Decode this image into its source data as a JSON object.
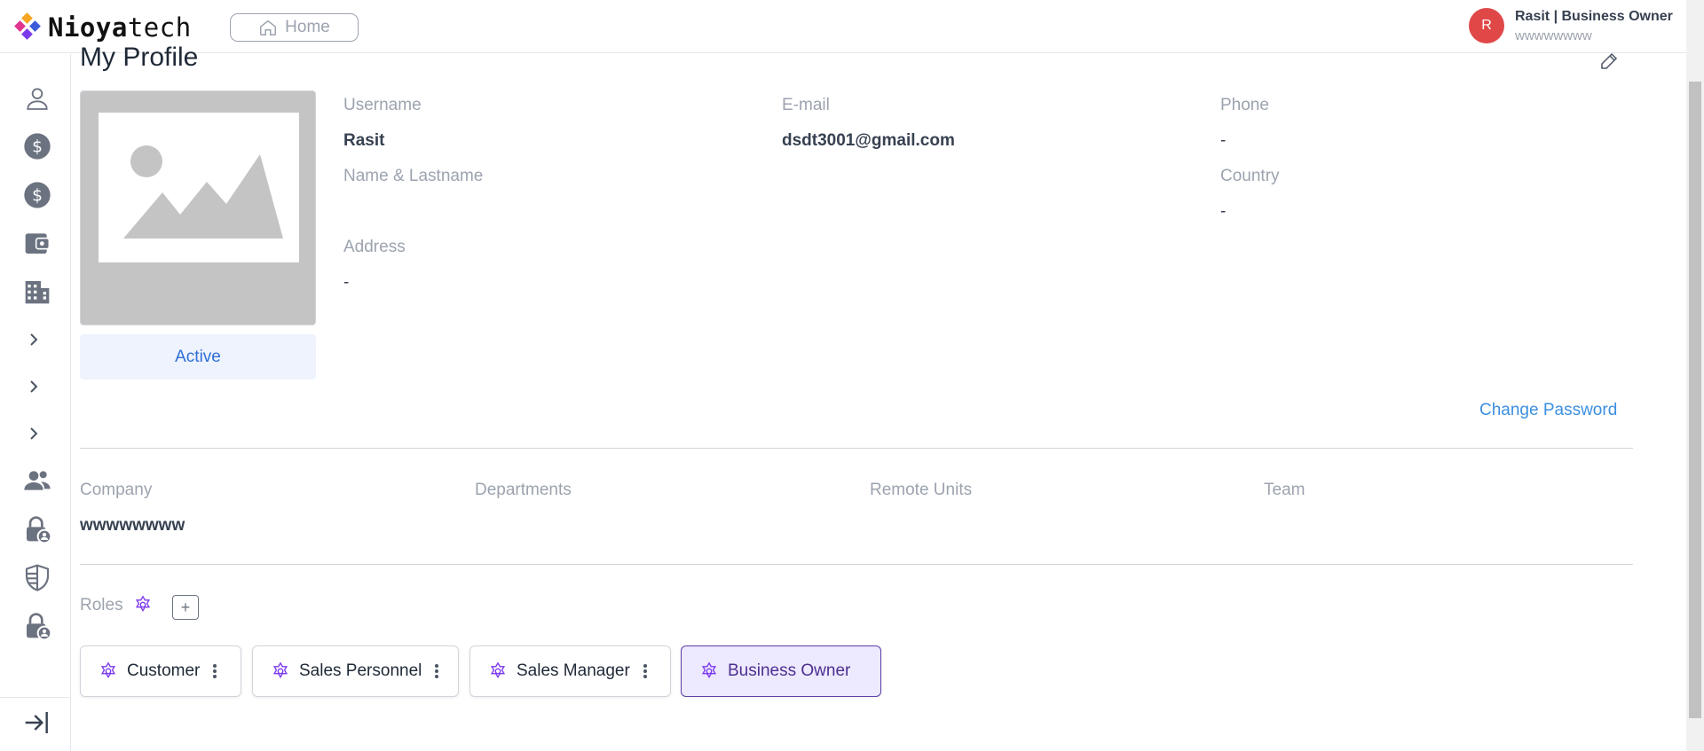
{
  "header": {
    "logo_text_bold": "Nioya",
    "logo_text_rest": "tech",
    "home_label": "Home",
    "user_initial": "R",
    "user_name": "Rasit | Business Owner",
    "user_company": "wwwwwwww"
  },
  "page": {
    "title": "My Profile",
    "status": "Active",
    "change_password": "Change Password"
  },
  "profile": {
    "username_label": "Username",
    "username": "Rasit",
    "email_label": "E-mail",
    "email": "dsdt3001@gmail.com",
    "phone_label": "Phone",
    "phone": "-",
    "name_label": "Name & Lastname",
    "country_label": "Country",
    "country": "-",
    "address_label": "Address",
    "address": "-"
  },
  "org": {
    "company_label": "Company",
    "company": "wwwwwwww",
    "departments_label": "Departments",
    "remote_units_label": "Remote Units",
    "team_label": "Team"
  },
  "roles": {
    "label": "Roles",
    "add_symbol": "+",
    "items": [
      {
        "name": "Customer"
      },
      {
        "name": "Sales Personnel"
      },
      {
        "name": "Sales Manager"
      },
      {
        "name": "Business Owner",
        "active": true
      }
    ]
  },
  "sidebar": {
    "icons": [
      "user-icon",
      "dollar-icon",
      "dollar-icon",
      "wallet-icon",
      "building-icon",
      "chevron-right-icon",
      "chevron-right-icon",
      "chevron-right-icon",
      "users-icon",
      "lock-user-icon",
      "shield-icon",
      "lock-user-icon",
      "logout-icon"
    ]
  },
  "colors": {
    "accent": "#7c3aed",
    "link": "#3b8fe0",
    "avatar": "#e04848",
    "status_bg": "#eef3fd"
  }
}
